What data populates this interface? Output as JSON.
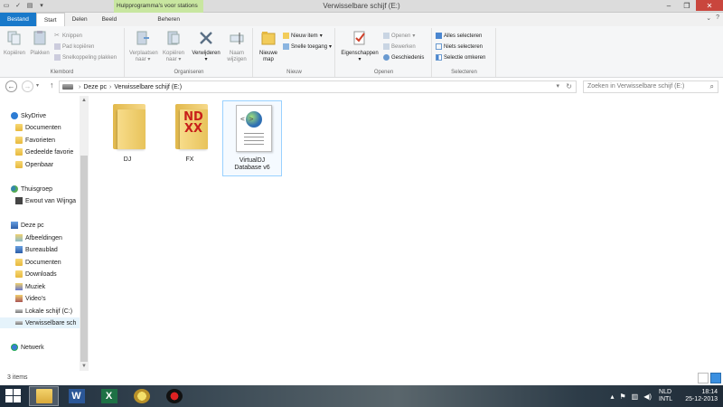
{
  "window": {
    "title": "Verwisselbare schijf (E:)",
    "context_header": "Hulpprogramma's voor stations"
  },
  "ribbon_tabs": [
    {
      "label": "Bestand"
    },
    {
      "label": "Start"
    },
    {
      "label": "Delen"
    },
    {
      "label": "Beeld"
    },
    {
      "label": "Beheren"
    }
  ],
  "ribbon": {
    "klembord": {
      "label": "Klembord",
      "kopieren": "Kopiëren",
      "plakken": "Plakken",
      "knippen": "Knippen",
      "pad_kopieren": "Pad kopiëren",
      "snelkoppeling_plakken": "Snelkoppeling plakken"
    },
    "organiseren": {
      "label": "Organiseren",
      "verplaatsen_l1": "Verplaatsen",
      "verplaatsen_l2": "naar",
      "kopieren_l1": "Kopiëren",
      "kopieren_l2": "naar",
      "verwijderen": "Verwijderen",
      "naam_l1": "Naam",
      "naam_l2": "wijzigen"
    },
    "nieuw": {
      "label": "Nieuw",
      "nieuwe_l1": "Nieuwe",
      "nieuwe_l2": "map",
      "nieuw_item": "Nieuw item",
      "snelle_toegang": "Snelle toegang"
    },
    "openen": {
      "label": "Openen",
      "eigenschappen": "Eigenschappen",
      "openen": "Openen",
      "bewerken": "Bewerken",
      "geschiedenis": "Geschiedenis"
    },
    "selecteren": {
      "label": "Selecteren",
      "alles": "Alles selecteren",
      "niets": "Niets selecteren",
      "omkeren": "Selectie omkeren"
    }
  },
  "address": {
    "crumb1": "Deze pc",
    "crumb2": "Verwisselbare schijf (E:)",
    "search_placeholder": "Zoeken in Verwisselbare schijf (E:)"
  },
  "nav": {
    "skydrive": "SkyDrive",
    "documenten": "Documenten",
    "favorieten": "Favorieten",
    "gedeelde": "Gedeelde favorie",
    "openbaar": "Openbaar",
    "thuisgroep": "Thuisgroep",
    "user": "Ewout van Wijnga",
    "deze_pc": "Deze pc",
    "afbeeldingen": "Afbeeldingen",
    "bureaublad": "Bureaublad",
    "documenten2": "Documenten",
    "downloads": "Downloads",
    "muziek": "Muziek",
    "videos": "Video's",
    "lokale": "Lokale schijf (C:)",
    "verwisselbare": "Verwisselbare sch",
    "netwerk": "Netwerk"
  },
  "files": [
    {
      "label": "DJ",
      "icon": "folder-icon"
    },
    {
      "label": "FX",
      "icon": "fx-folder-icon"
    },
    {
      "label": "VirtualDJ Database v6",
      "icon": "xml-document-icon"
    }
  ],
  "status": {
    "items": "3 items"
  },
  "tray": {
    "lang1": "NLD",
    "lang2": "INTL",
    "time": "18:14",
    "date": "25-12-2013"
  },
  "colors": {
    "accent": "#1979ca",
    "context": "#c8e6a0",
    "close": "#c9463d",
    "selection": "#99d1ff"
  }
}
